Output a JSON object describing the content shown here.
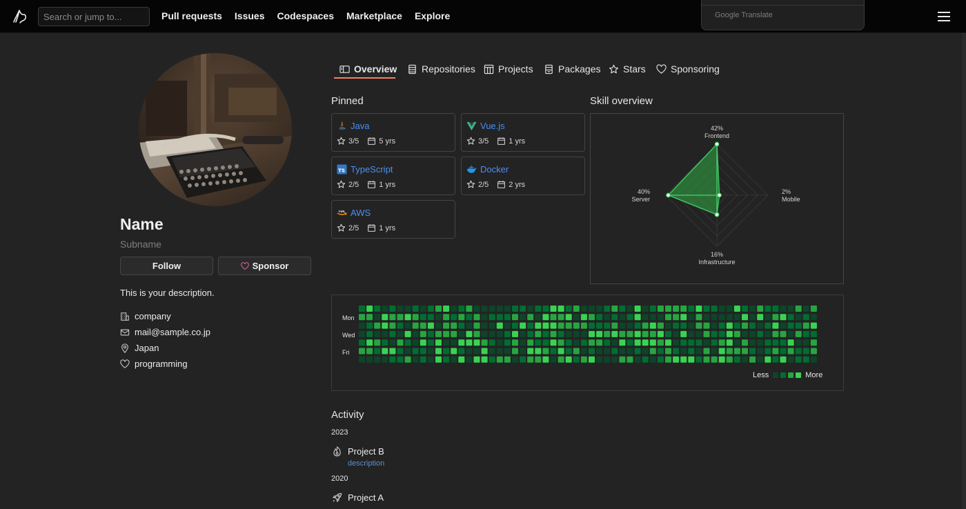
{
  "header": {
    "search_placeholder": "Search or jump to...",
    "nav": [
      "Pull requests",
      "Issues",
      "Codespaces",
      "Marketplace",
      "Explore"
    ],
    "translate_label": "Google Translate"
  },
  "profile": {
    "name": "Name",
    "subname": "Subname",
    "follow_label": "Follow",
    "sponsor_label": "Sponsor",
    "description": "This is your description.",
    "details": [
      {
        "icon": "building-icon",
        "text": "company"
      },
      {
        "icon": "mail-icon",
        "text": "mail@sample.co.jp"
      },
      {
        "icon": "location-icon",
        "text": "Japan"
      },
      {
        "icon": "heart-icon",
        "text": "programming"
      }
    ]
  },
  "tabs": [
    {
      "label": "Overview",
      "icon": "book-icon",
      "active": true
    },
    {
      "label": "Repositories",
      "icon": "repo-icon"
    },
    {
      "label": "Projects",
      "icon": "table-icon"
    },
    {
      "label": "Packages",
      "icon": "package-icon"
    },
    {
      "label": "Stars",
      "icon": "star-icon"
    },
    {
      "label": "Sponsoring",
      "icon": "heart-icon"
    }
  ],
  "pinned": {
    "title": "Pinned",
    "cards": [
      {
        "name": "Java",
        "icon": "java-icon",
        "rating": "3/5",
        "years": "5 yrs"
      },
      {
        "name": "Vue.js",
        "icon": "vue-icon",
        "rating": "3/5",
        "years": "1 yrs"
      },
      {
        "name": "TypeScript",
        "icon": "typescript-icon",
        "rating": "2/5",
        "years": "1 yrs"
      },
      {
        "name": "Docker",
        "icon": "docker-icon",
        "rating": "2/5",
        "years": "2 yrs"
      },
      {
        "name": "AWS",
        "icon": "aws-icon",
        "rating": "2/5",
        "years": "1 yrs"
      }
    ]
  },
  "skill": {
    "title": "Skill overview"
  },
  "chart_data": {
    "type": "radar",
    "axes": [
      {
        "label": "Frontend",
        "percent": "42%",
        "value": 42
      },
      {
        "label": "Mobile",
        "percent": "2%",
        "value": 2
      },
      {
        "label": "Infrastructure",
        "percent": "16%",
        "value": 16
      },
      {
        "label": "Server",
        "percent": "40%",
        "value": 40
      }
    ],
    "max": 42,
    "fill_color": "#2ea043",
    "line_color": "#40c463"
  },
  "contributions": {
    "day_labels": [
      "Mon",
      "Wed",
      "Fri"
    ],
    "legend_less": "Less",
    "legend_more": "More",
    "colors": [
      "#0e4429",
      "#006d32",
      "#26a641",
      "#39d353"
    ],
    "weeks": 60
  },
  "activity": {
    "title": "Activity",
    "groups": [
      {
        "year": "2023",
        "items": [
          {
            "name": "Project B",
            "icon": "flame-icon",
            "description": "description"
          }
        ]
      },
      {
        "year": "2020",
        "items": [
          {
            "name": "Project A",
            "icon": "rocket-icon"
          }
        ]
      }
    ]
  }
}
